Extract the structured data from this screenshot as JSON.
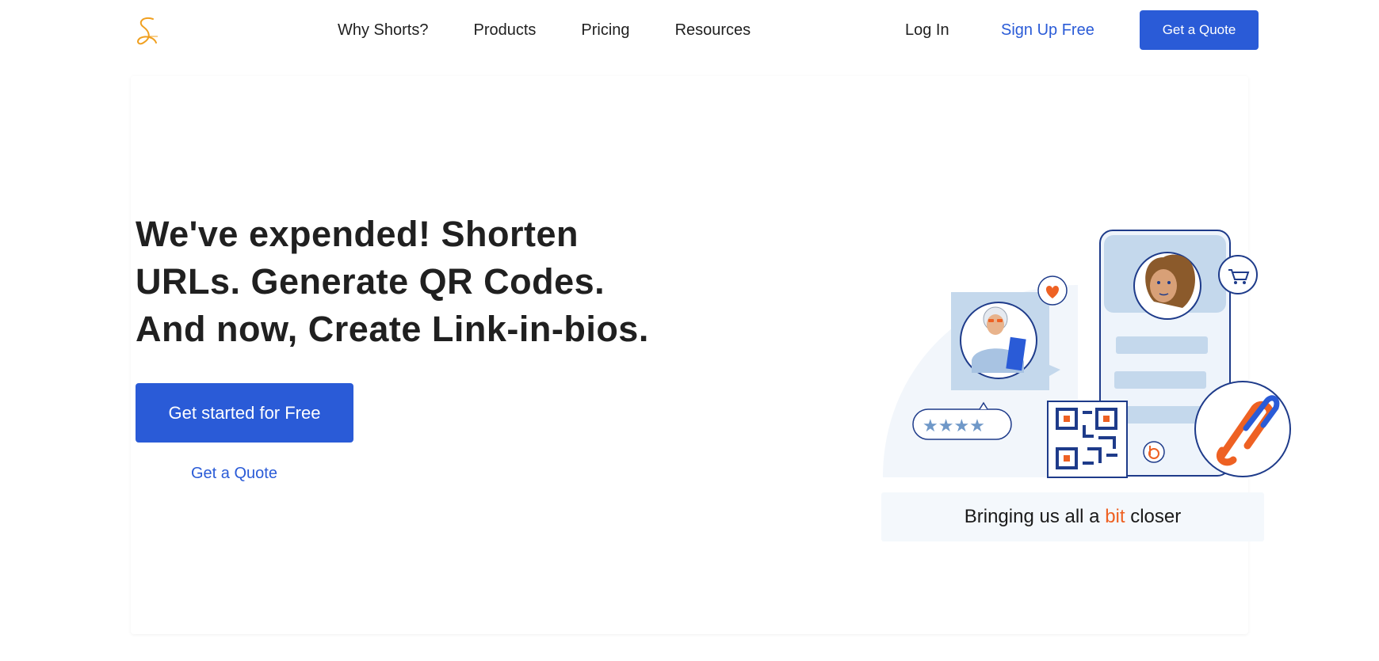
{
  "nav": {
    "logo_icon": "script-s-logo-icon",
    "links": [
      "Why Shorts?",
      "Products",
      "Pricing",
      "Resources"
    ],
    "login": "Log In",
    "signup": "Sign Up Free",
    "quote": "Get a Quote"
  },
  "hero": {
    "headline_lines": [
      "We've expended! Shorten",
      "URLs. Generate QR Codes.",
      "And now, Create Link-in-bios."
    ],
    "cta": "Get started for Free",
    "quote_link": "Get a Quote"
  },
  "illustration": {
    "tagline_before": "Bringing us all a ",
    "tagline_accent": "bit",
    "tagline_after": " closer"
  },
  "colors": {
    "brand_blue": "#2a5bd7",
    "accent_orange": "#ee6123",
    "logo_orange": "#f0a020",
    "illustration_light_blue": "#c4d8ec",
    "illustration_navy": "#1e3b8a"
  }
}
